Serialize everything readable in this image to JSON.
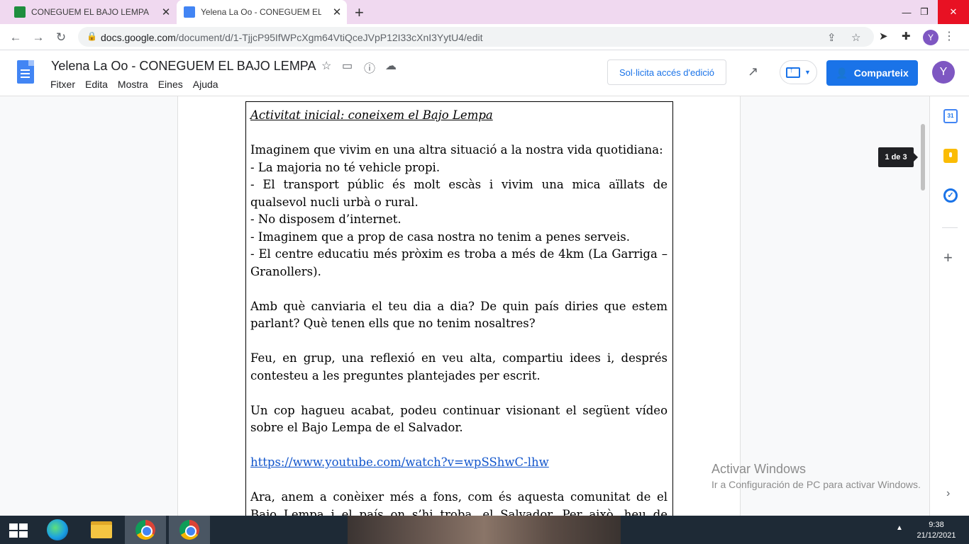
{
  "browser": {
    "tabs": [
      {
        "title": "CONEGUEM EL BAJO LEMPA",
        "favicon_color": "#4285f4",
        "active": false
      },
      {
        "title": "Yelena La Oo - CONEGUEM EL BA",
        "favicon_color": "#4285f4",
        "active": true
      }
    ],
    "url_host": "docs.google.com",
    "url_path": "/document/d/1-TjjcP95IfWPcXgm64VtiQceJVpP12I33cXnI3YytU4/edit",
    "profile_initial": "Y"
  },
  "docs": {
    "title": "Yelena La Oo - CONEGUEM EL BAJO LEMPA",
    "menu": [
      "Fitxer",
      "Edita",
      "Mostra",
      "Eines",
      "Ajuda"
    ],
    "request_access_label": "Sol·licita accés d'edició",
    "share_label": "Comparteix",
    "avatar_initial": "Y",
    "accent_color": "#1a73e8"
  },
  "document": {
    "heading": "Activitat inicial: coneixem el Bajo Lempa",
    "intro": "Imaginem que vivim en una altra situació a la nostra vida quotidiana:",
    "bullets": [
      "- La majoria no té vehicle propi.",
      "- El transport públic és molt escàs i vivim una mica aïllats de qualsevol nucli urbà o rural.",
      "- No disposem d’internet.",
      "- Imaginem que a prop de casa nostra no tenim a penes serveis.",
      "- El centre educatiu més pròxim es troba a més de 4km (La Garriga – Granollers)."
    ],
    "question": "Amb què canviaria el teu dia a dia? De quin país diries que estem parlant? Què tenen ells que no tenim nosaltres?",
    "instruction": "Feu, en grup, una reflexió en veu alta, compartiu idees i, després contesteu a les preguntes plantejades per escrit.",
    "video_intro": "Un cop hagueu acabat, podeu continuar visionant el següent vídeo sobre el Bajo Lempa de el Salvador.",
    "video_link": "https://www.youtube.com/watch?v=wpSShwC-lhw",
    "closing": "Ara, anem a conèixer més a fons, com és aquesta comunitat de el Bajo Lempa i el país on s’hi troba, el Salvador. Per això, heu de buscar"
  },
  "page_indicator": "1 de 3",
  "side_panel": {
    "calendar_day": "31"
  },
  "watermark": {
    "title": "Activar Windows",
    "subtitle": "Ir a Configuración de PC para activar Windows."
  },
  "taskbar": {
    "time": "9:38",
    "date": "21/12/2021"
  }
}
